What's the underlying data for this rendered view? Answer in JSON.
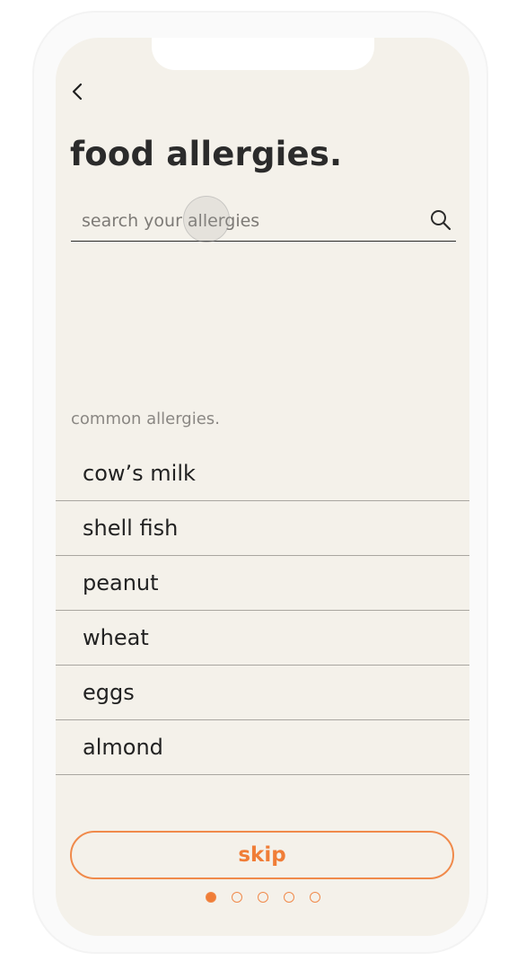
{
  "header": {
    "back_icon": "chevron-left-icon",
    "title": "food allergies."
  },
  "search": {
    "placeholder": "search your allergies",
    "value": "",
    "icon": "search-icon"
  },
  "common": {
    "label": "common allergies.",
    "items": [
      {
        "label": "cow’s milk"
      },
      {
        "label": "shell fish"
      },
      {
        "label": "peanut"
      },
      {
        "label": "wheat"
      },
      {
        "label": "eggs"
      },
      {
        "label": "almond"
      }
    ]
  },
  "footer": {
    "skip_label": "skip",
    "pagination": {
      "total": 5,
      "current": 1
    }
  },
  "colors": {
    "background": "#f4f1ea",
    "accent": "#f07d37",
    "text": "#2b2b2b"
  }
}
